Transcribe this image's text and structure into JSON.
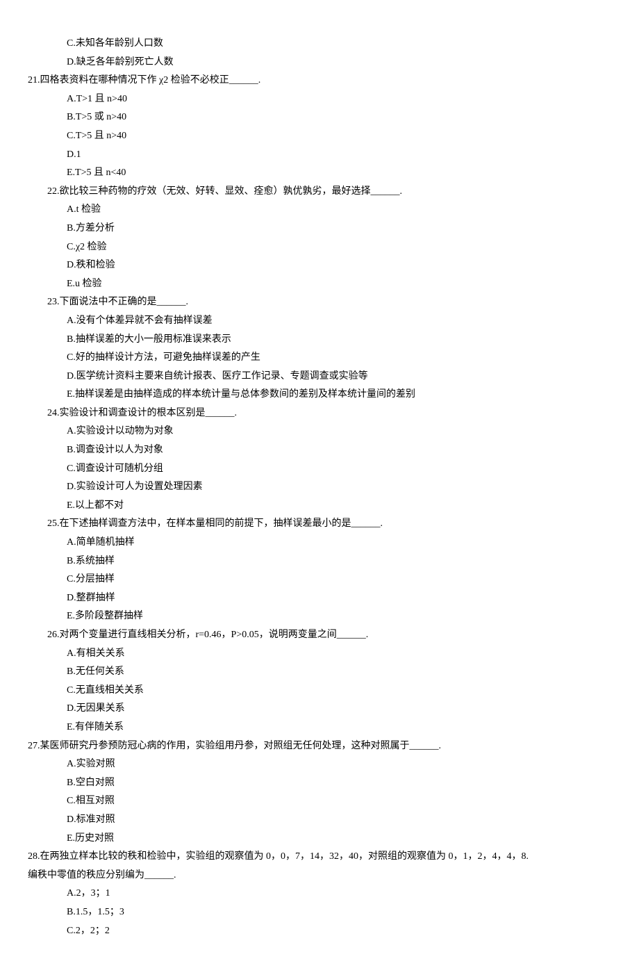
{
  "lines": [
    {
      "cls": "option",
      "text": "C.未知各年龄别人口数"
    },
    {
      "cls": "option",
      "text": "D.缺乏各年龄别死亡人数"
    },
    {
      "cls": "question",
      "text": "21.四格表资料在哪种情况下作 χ2 检验不必校正______."
    },
    {
      "cls": "option",
      "text": "A.T>1 且 n>40"
    },
    {
      "cls": "option",
      "text": "B.T>5 或 n>40"
    },
    {
      "cls": "option",
      "text": "C.T>5 且 n>40"
    },
    {
      "cls": "option",
      "text": "D.1"
    },
    {
      "cls": "option",
      "text": "E.T>5 且 n<40"
    },
    {
      "cls": "question indent",
      "text": "22.欲比较三种药物的疗效（无效、好转、显效、痊愈）孰优孰劣，最好选择______."
    },
    {
      "cls": "option",
      "text": "A.t 检验"
    },
    {
      "cls": "option",
      "text": "B.方差分析"
    },
    {
      "cls": "option",
      "text": "C.χ2 检验"
    },
    {
      "cls": "option",
      "text": "D.秩和检验"
    },
    {
      "cls": "option",
      "text": "E.u 检验"
    },
    {
      "cls": "question indent",
      "text": "23.下面说法中不正确的是______."
    },
    {
      "cls": "option",
      "text": "A.没有个体差异就不会有抽样误差"
    },
    {
      "cls": "option",
      "text": "B.抽样误差的大小一般用标准误来表示"
    },
    {
      "cls": "option",
      "text": "C.好的抽样设计方法，可避免抽样误差的产生"
    },
    {
      "cls": "option",
      "text": "D.医学统计资料主要来自统计报表、医疗工作记录、专题调查或实验等"
    },
    {
      "cls": "option",
      "text": "E.抽样误差是由抽样造成的样本统计量与总体参数间的差别及样本统计量间的差别"
    },
    {
      "cls": "question indent",
      "text": "24.实验设计和调查设计的根本区别是______."
    },
    {
      "cls": "option",
      "text": "A.实验设计以动物为对象"
    },
    {
      "cls": "option",
      "text": "B.调查设计以人为对象"
    },
    {
      "cls": "option",
      "text": "C.调查设计可随机分组"
    },
    {
      "cls": "option",
      "text": "D.实验设计可人为设置处理因素"
    },
    {
      "cls": "option",
      "text": "E.以上都不对"
    },
    {
      "cls": "question indent",
      "text": "25.在下述抽样调查方法中，在样本量相同的前提下，抽样误差最小的是______."
    },
    {
      "cls": "option",
      "text": "A.简单随机抽样"
    },
    {
      "cls": "option",
      "text": "B.系统抽样"
    },
    {
      "cls": "option",
      "text": "C.分层抽样"
    },
    {
      "cls": "option",
      "text": "D.整群抽样"
    },
    {
      "cls": "option",
      "text": "E.多阶段整群抽样"
    },
    {
      "cls": "question indent",
      "text": "26.对两个变量进行直线相关分析，r=0.46，P>0.05，说明两变量之间______."
    },
    {
      "cls": "option",
      "text": "A.有相关关系"
    },
    {
      "cls": "option",
      "text": "B.无任何关系"
    },
    {
      "cls": "option",
      "text": "C.无直线相关关系"
    },
    {
      "cls": "option",
      "text": "D.无因果关系"
    },
    {
      "cls": "option",
      "text": "E.有伴随关系"
    },
    {
      "cls": "question",
      "text": "27.某医师研究丹参预防冠心病的作用，实验组用丹参，对照组无任何处理，这种对照属于______."
    },
    {
      "cls": "option",
      "text": "A.实验对照"
    },
    {
      "cls": "option",
      "text": "B.空白对照"
    },
    {
      "cls": "option",
      "text": "C.相互对照"
    },
    {
      "cls": "option",
      "text": "D.标准对照"
    },
    {
      "cls": "option",
      "text": "E.历史对照"
    },
    {
      "cls": "question",
      "text": "28.在两独立样本比较的秩和检验中，实验组的观察值为 0，0，7，14，32，40，对照组的观察值为 0，1，2，4，4，8."
    },
    {
      "cls": "q28-line2",
      "text": "编秩中零值的秩应分别编为______."
    },
    {
      "cls": "option",
      "text": "A.2，3；1"
    },
    {
      "cls": "option",
      "text": "B.1.5，1.5；3"
    },
    {
      "cls": "option",
      "text": "C.2，2；2"
    }
  ]
}
